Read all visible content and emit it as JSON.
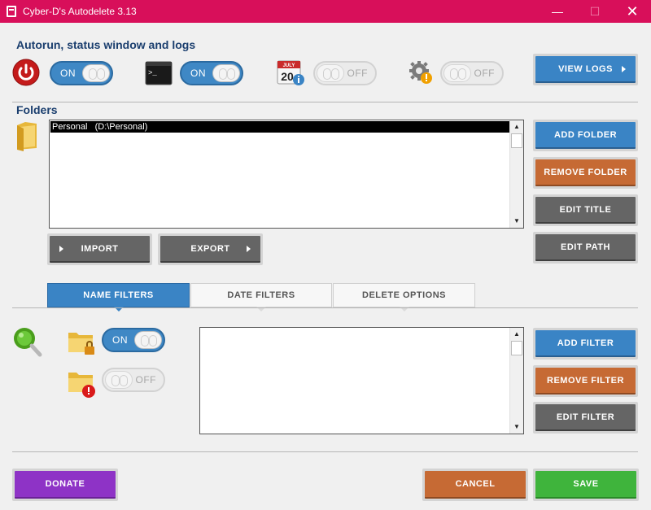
{
  "window": {
    "title": "Cyber-D's Autodelete 3.13",
    "minimize": "—",
    "maximize": "☐",
    "close": "✕"
  },
  "autorun": {
    "heading": "Autorun, status window and logs",
    "toggles": [
      {
        "state": "ON"
      },
      {
        "state": "ON"
      },
      {
        "state": "OFF"
      },
      {
        "state": "OFF"
      }
    ],
    "calendar": {
      "month": "JULY",
      "day": "20"
    },
    "view_logs": "VIEW LOGS"
  },
  "folders": {
    "heading": "Folders",
    "items": [
      {
        "label": "Personal   (D:\\Personal)",
        "selected": true
      }
    ],
    "add_folder": "ADD FOLDER",
    "remove_folder": "REMOVE FOLDER",
    "edit_title": "EDIT TITLE",
    "edit_path": "EDIT PATH",
    "import": "IMPORT",
    "export": "EXPORT"
  },
  "tabs": [
    {
      "label": "NAME FILTERS",
      "active": true
    },
    {
      "label": "DATE FILTERS",
      "active": false
    },
    {
      "label": "DELETE OPTIONS",
      "active": false
    }
  ],
  "filters": {
    "include_toggle": "ON",
    "exclude_toggle": "OFF",
    "items": [],
    "add_filter": "ADD FILTER",
    "remove_filter": "REMOVE FILTER",
    "edit_filter": "EDIT FILTER"
  },
  "footer": {
    "donate": "DONATE",
    "cancel": "CANCEL",
    "save": "SAVE"
  },
  "colors": {
    "titlebar": "#d80f5a",
    "accent_blue": "#3a84c5",
    "orange": "#c66a34",
    "grey": "#656565",
    "purple": "#8e33c6",
    "green": "#3fb43c"
  }
}
